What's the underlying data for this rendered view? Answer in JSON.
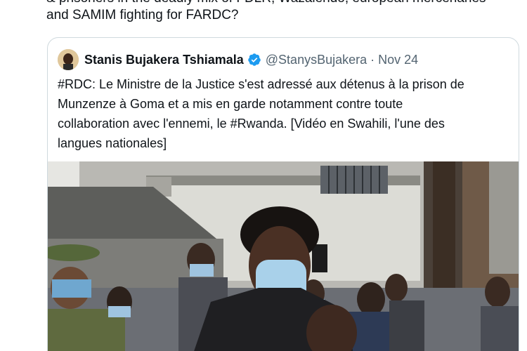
{
  "tweet": {
    "text_lines": [
      "& prisoners in the deadly mix of FDLR, Wazalendo, european mercenaries",
      "and SAMIM fighting for FARDC?"
    ]
  },
  "quoted_tweet": {
    "author_name": "Stanis Bujakera Tshiamala",
    "handle": "@StanysBujakera",
    "separator": "·",
    "date": "Nov 24",
    "text_lines": [
      "#RDC: Le Ministre de la Justice s'est adressé aux détenus à la prison de",
      "Munzenze à Goma et a mis en garde notamment contre toute",
      "collaboration avec l'ennemi, le #Rwanda. [Vidéo en Swahili, l'une des",
      "langues nationales]"
    ],
    "verified_icon": "verified-badge-icon",
    "verified_color": "#1d9bf0"
  }
}
